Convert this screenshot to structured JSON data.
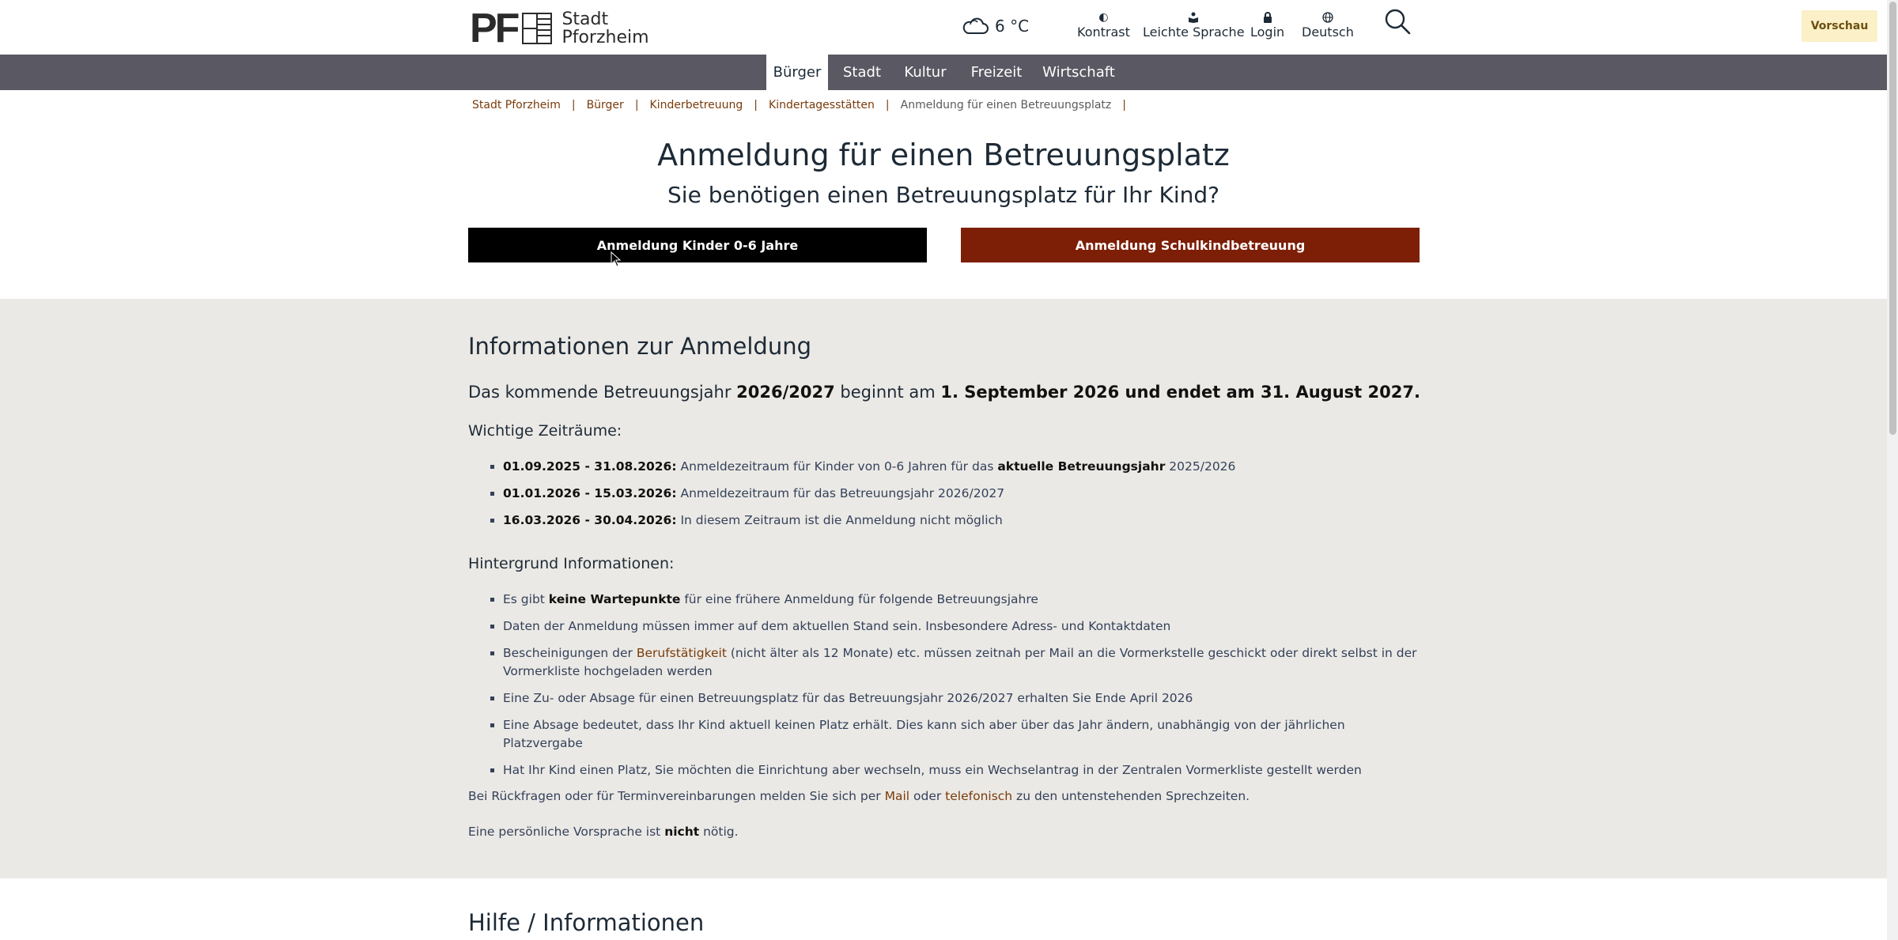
{
  "header": {
    "logo_pf": "PF",
    "logo_text_1": "Stadt",
    "logo_text_2": "Pforzheim",
    "weather_temp": "6 °C",
    "utils": [
      {
        "label": "Kontrast",
        "icon": "contrast-icon"
      },
      {
        "label": "Leichte Sprache",
        "icon": "easy-language-icon"
      },
      {
        "label": "Login",
        "icon": "lock-icon"
      },
      {
        "label": "Deutsch",
        "icon": "globe-icon"
      }
    ],
    "preview_label": "Vorschau"
  },
  "nav": {
    "items": [
      {
        "label": "Bürger",
        "active": true
      },
      {
        "label": "Stadt"
      },
      {
        "label": "Kultur"
      },
      {
        "label": "Freizeit"
      },
      {
        "label": "Wirtschaft"
      }
    ]
  },
  "breadcrumb": {
    "items": [
      "Stadt Pforzheim",
      "Bürger",
      "Kinderbetreuung",
      "Kindertagesstätten"
    ],
    "current": "Anmeldung für einen Betreuungsplatz",
    "separator": "|"
  },
  "main": {
    "title": "Anmeldung für einen Betreuungsplatz",
    "subtitle": "Sie benötigen einen Betreuungsplatz für Ihr Kind?",
    "button_kinder": "Anmeldung Kinder 0-6 Jahre",
    "button_schulkind": "Anmeldung Schulkindbetreuung"
  },
  "info": {
    "title": "Informationen zur Anmeldung",
    "lead_1": "Das kommende Betreuungsjahr ",
    "lead_year": "2026/2027",
    "lead_2": " beginnt am ",
    "lead_3": "1. September 2026 und endet am 31. August 2027.",
    "zeitraeume_title": "Wichtige Zeiträume:",
    "zeitraeume": [
      {
        "date": "01.09.2025 - 31.08.2026:",
        "text_1": " Anmeldezeitraum für Kinder von 0-6 Jahren für das ",
        "bold": "aktuelle Betreuungsjahr",
        "text_2": " 2025/2026"
      },
      {
        "date": "01.01.2026 - 15.03.2026:",
        "text_1": " Anmeldezeitraum für das Betreuungsjahr 2026/2027"
      },
      {
        "date": "16.03.2026 - 30.04.2026:",
        "text_1": " In diesem Zeitraum ist die Anmeldung nicht möglich"
      }
    ],
    "hintergrund_title": "Hintergrund Informationen:",
    "hintergrund_1a": "Es gibt ",
    "hintergrund_1b": "keine Wartepunkte",
    "hintergrund_1c": " für eine frühere Anmeldung für folgende Betreuungsjahre",
    "hintergrund_2": "Daten der Anmeldung müssen immer auf dem aktuellen Stand sein. Insbesondere Adress- und Kontaktdaten",
    "hintergrund_3a": "Bescheinigungen der ",
    "hintergrund_3_link": "Berufstätigkeit",
    "hintergrund_3b": " (nicht älter als 12 Monate) etc. müssen zeitnah per Mail an die Vormerkstelle geschickt oder direkt selbst in der Vormerkliste hochgeladen werden",
    "hintergrund_4": "Eine Zu- oder Absage für einen Betreuungsplatz für das Betreuungsjahr 2026/2027 erhalten Sie Ende April 2026",
    "hintergrund_5": "Eine Absage bedeutet, dass Ihr Kind aktuell keinen Platz erhält. Dies kann sich aber über das Jahr ändern, unabhängig von der jährlichen Platzvergabe",
    "hintergrund_6": "Hat Ihr Kind einen Platz, Sie möchten die Einrichtung aber wechseln, muss ein Wechselantrag in der Zentralen Vormerkliste gestellt werden",
    "contact_1": "Bei Rückfragen oder für Terminvereinbarungen melden Sie sich per ",
    "contact_mail": "Mail",
    "contact_2": " oder ",
    "contact_phone": "telefonisch",
    "contact_3": " zu den untenstehenden Sprechzeiten.",
    "visit_1": "Eine persönliche Vorsprache ist ",
    "visit_bold": "nicht",
    "visit_2": " nötig."
  },
  "help_title": "Hilfe / Informationen",
  "colors": {
    "nav_bg": "#5a5862",
    "button_primary": "#000000",
    "button_secondary": "#7d1e06",
    "link": "#7a3b0a",
    "section_bg": "#ebe9e5",
    "preview_bg": "#fbf0c7"
  }
}
